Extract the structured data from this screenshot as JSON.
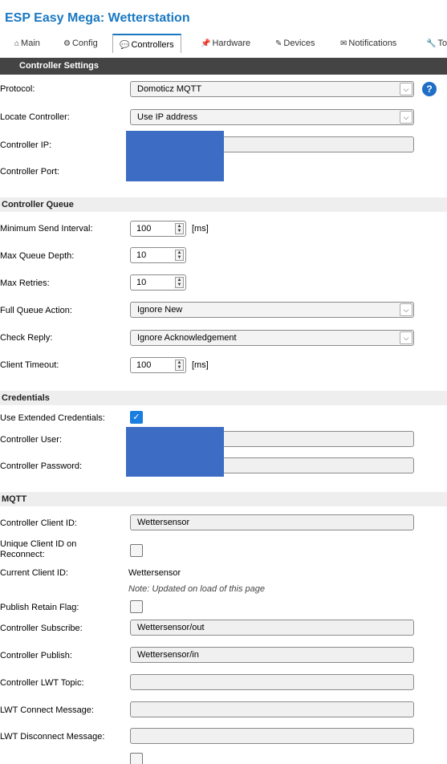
{
  "app": {
    "title": "ESP Easy Mega: Wetterstation"
  },
  "tabs": [
    {
      "icon": "⌂",
      "label": "Main"
    },
    {
      "icon": "⚙",
      "label": "Config"
    },
    {
      "icon": "💬",
      "label": "Controllers"
    },
    {
      "icon": "📌",
      "label": "Hardware"
    },
    {
      "icon": "✎",
      "label": "Devices"
    },
    {
      "icon": "✉",
      "label": "Notifications"
    },
    {
      "icon": "🔧",
      "label": "To"
    }
  ],
  "header": {
    "label": "Controller Settings"
  },
  "settings": {
    "protocol_label": "Protocol:",
    "protocol_value": "Domoticz MQTT",
    "locate_label": "Locate Controller:",
    "locate_value": "Use IP address",
    "ip_label": "Controller IP:",
    "port_label": "Controller Port:"
  },
  "queue": {
    "section": "Controller Queue",
    "min_interval_label": "Minimum Send Interval:",
    "min_interval_value": "100",
    "min_interval_unit": "[ms]",
    "max_depth_label": "Max Queue Depth:",
    "max_depth_value": "10",
    "max_retries_label": "Max Retries:",
    "max_retries_value": "10",
    "full_action_label": "Full Queue Action:",
    "full_action_value": "Ignore New",
    "check_reply_label": "Check Reply:",
    "check_reply_value": "Ignore Acknowledgement",
    "timeout_label": "Client Timeout:",
    "timeout_value": "100",
    "timeout_unit": "[ms]"
  },
  "credentials": {
    "section": "Credentials",
    "extended_label": "Use Extended Credentials:",
    "extended_checked": true,
    "user_label": "Controller User:",
    "password_label": "Controller Password:"
  },
  "mqtt": {
    "section": "MQTT",
    "client_id_label": "Controller Client ID:",
    "client_id_value": "Wettersensor",
    "unique_label_1": "Unique Client ID on",
    "unique_label_2": "Reconnect:",
    "current_id_label": "Current Client ID:",
    "current_id_value": "Wettersensor",
    "note": "Note: Updated on load of this page",
    "retain_label": "Publish Retain Flag:",
    "subscribe_label": "Controller Subscribe:",
    "subscribe_value": "Wettersensor/out",
    "publish_label": "Controller Publish:",
    "publish_value": "Wettersensor/in",
    "lwt_topic_label": "Controller LWT Topic:",
    "lwt_topic_value": "",
    "lwt_connect_label": "LWT Connect Message:",
    "lwt_connect_value": "",
    "lwt_disconnect_label": "LWT Disconnect Message:",
    "lwt_disconnect_value": ""
  },
  "colors": {
    "accent": "#1a78c2",
    "header_bg": "#444444",
    "checkbox_on": "#1a7de0",
    "redaction": "#3c6cc4"
  }
}
